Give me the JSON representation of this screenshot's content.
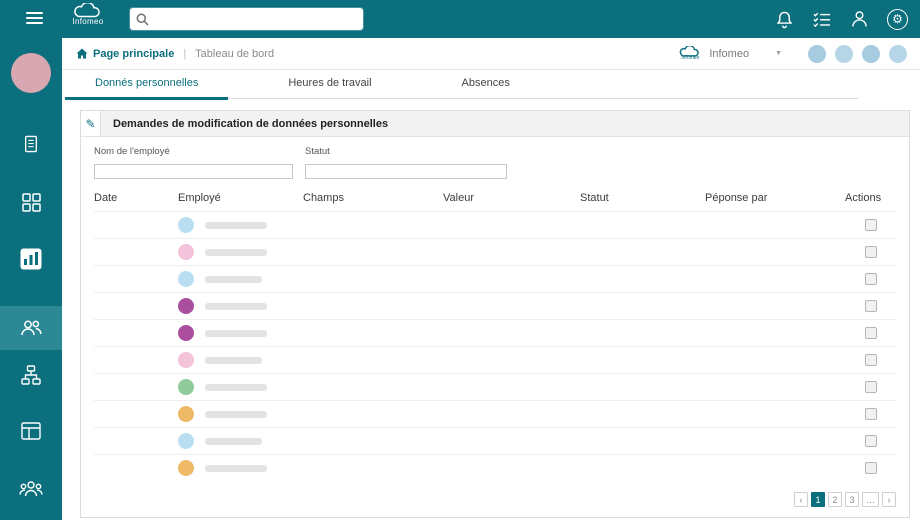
{
  "topbar": {
    "brand": "Infomeo",
    "search": {
      "placeholder": "",
      "value": ""
    },
    "icons": [
      "hamburger-menu",
      "notifications-bell",
      "task-list",
      "user",
      "settings-gear"
    ]
  },
  "sidebar": {
    "icons": [
      "user-avatar",
      "document",
      "apps-grid",
      "dashboard-tile",
      "employees",
      "org-chart",
      "layout-grid",
      "team"
    ],
    "active": "employees"
  },
  "breadcrumb": {
    "home_label": "Page principale",
    "separator": "|",
    "current": "Tableau de bord"
  },
  "account": {
    "company": "Infomeo",
    "caret": "▼"
  },
  "tabs": [
    {
      "label": "Donnés personnelles",
      "active": true
    },
    {
      "label": "Heures de travail",
      "active": false
    },
    {
      "label": "Absences",
      "active": false
    }
  ],
  "panel": {
    "title": "Demandes de modification de données personnelles",
    "edit_icon": "✎",
    "filters": {
      "name_label": "Nom de l'employé",
      "name_value": "",
      "status_label": "Statut",
      "status_value": ""
    },
    "table": {
      "columns": [
        "Date",
        "Employé",
        "Champs",
        "Valeur",
        "Statut",
        "Péponse par",
        "Actions"
      ],
      "rows": [
        {
          "avatar_color": "#badef1",
          "status_color": "#6991bb"
        },
        {
          "avatar_color": "#f3c3d9",
          "status_color": "#c81e2e"
        },
        {
          "avatar_color": "#badef1",
          "status_color": "#0a9c00"
        },
        {
          "avatar_color": "#a94f9e",
          "status_color": "#6991bb"
        },
        {
          "avatar_color": "#a94f9e",
          "status_color": "#c81e2e"
        },
        {
          "avatar_color": "#f3c3d9",
          "status_color": "#6991bb"
        },
        {
          "avatar_color": "#8fca9c",
          "status_color": "#0a9c00"
        },
        {
          "avatar_color": "#edb966",
          "status_color": "#c81e2e"
        },
        {
          "avatar_color": "#badef1",
          "status_color": "#0a9c00"
        },
        {
          "avatar_color": "#edb966",
          "status_color": "#0a9c00"
        }
      ]
    },
    "pagination": {
      "prev": "‹",
      "pages": [
        "1",
        "2",
        "3",
        "…"
      ],
      "active_page": "1",
      "next": "›"
    }
  },
  "colors": {
    "topbar_teal": "#0c6f7d",
    "sidebar_active": "#2c8894",
    "status_blue": "#6991bb",
    "status_red": "#c81e2e",
    "status_green": "#0a9c00",
    "skeleton_gray": "#e3e3e3",
    "header_avatar_blue": "#a7cce1",
    "sidebar_avatar_pink": "#d9a7b1"
  }
}
